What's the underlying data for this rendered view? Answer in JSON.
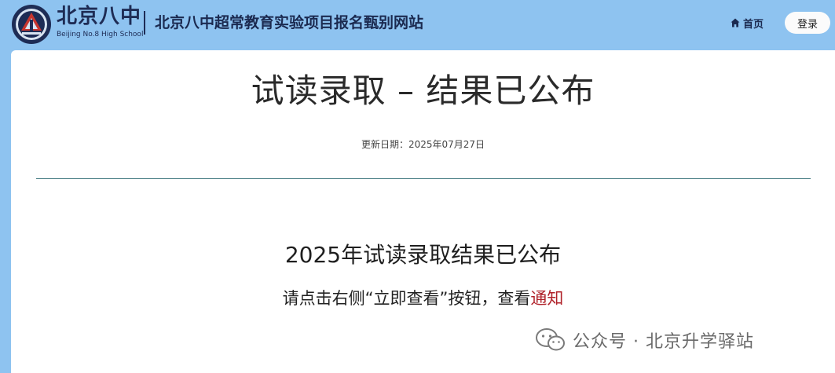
{
  "header": {
    "logo_cn": "北京八中",
    "logo_en": "Beijing No.8 High School",
    "site_title": "北京八中超常教育实验项目报名甄别网站",
    "nav_home": "首页",
    "login": "登录"
  },
  "main": {
    "title": "试读录取 – 结果已公布",
    "update_date": "更新日期：2025年07月27日",
    "subheading": "2025年试读录取结果已公布",
    "instruction_prefix": "请点击右侧“立即查看”按钮，查看",
    "instruction_link": "通知"
  },
  "watermark": {
    "text": "公众号 · 北京升学驿站"
  },
  "colors": {
    "header_bg": "#8ec3f0",
    "link": "#b0222a",
    "divider": "#4a7f86"
  }
}
